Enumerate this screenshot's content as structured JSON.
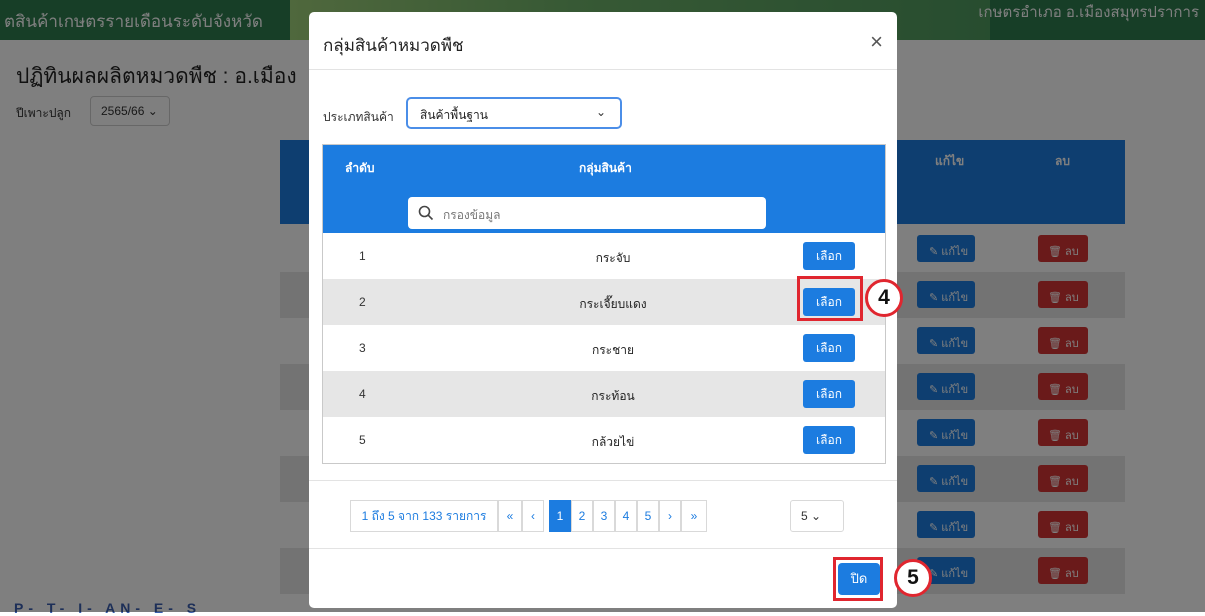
{
  "background": {
    "header_title": "ตสินค้าเกษตรรายเดือนระดับจังหวัด",
    "header_right": "เกษตรอำเภอ อ.เมืองสมุทรปราการ",
    "page_title": "ปฏิทินผลผลิตหมวดพืช : อ.เมือง",
    "season_label": "ปีเพาะปลูก",
    "season_value": "2565/66",
    "col_edit": "แก้ไข",
    "col_delete": "ลบ",
    "edit_label": "แก้ไข",
    "delete_label": "ลบ",
    "bottom_text": "P- T- I- AN- E- S"
  },
  "modal": {
    "title": "กลุ่มสินค้าหมวดพืช",
    "close_icon": "×",
    "type_label": "ประเภทสินค้า",
    "type_value": "สินค้าพื้นฐาน",
    "columns": {
      "no": "ลำดับ",
      "group": "กลุ่มสินค้า"
    },
    "filter_placeholder": "กรองข้อมูล",
    "rows": [
      {
        "no": "1",
        "name": "กระจับ",
        "action": "เลือก"
      },
      {
        "no": "2",
        "name": "กระเจี๊ยบแดง",
        "action": "เลือก"
      },
      {
        "no": "3",
        "name": "กระชาย",
        "action": "เลือก"
      },
      {
        "no": "4",
        "name": "กระท้อน",
        "action": "เลือก"
      },
      {
        "no": "5",
        "name": "กล้วยไข่",
        "action": "เลือก"
      }
    ],
    "pager": {
      "summary": "1 ถึง 5 จาก 133 รายการ",
      "first": "«",
      "prev": "‹",
      "pages": [
        "1",
        "2",
        "3",
        "4",
        "5"
      ],
      "next": "›",
      "last": "»",
      "page_size": "5"
    },
    "close_label": "ปิด"
  },
  "annotations": {
    "step4": "4",
    "step5": "5",
    "color": "#e0262f"
  },
  "colors": {
    "primary": "#1c7ce0",
    "danger": "#d43535",
    "header_green": "#2e7d4f"
  }
}
